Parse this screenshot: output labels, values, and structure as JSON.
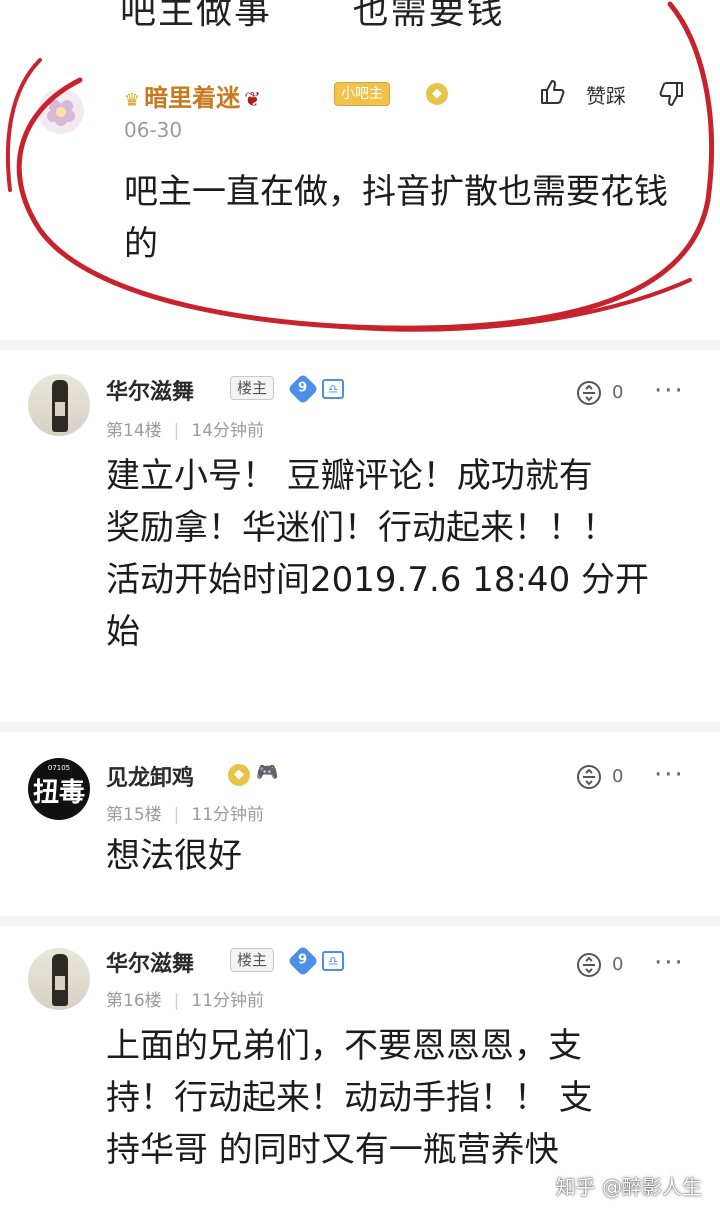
{
  "top_fragment": "吧主做事... 也需要钱",
  "replies": [
    {
      "username": "暗里着迷",
      "badge": "小吧主",
      "date": "06-30",
      "like_label": "赞踩",
      "content": "吧主一直在做，抖音扩散也需要花钱的"
    },
    {
      "username": "华尔滋舞",
      "badge": "楼主",
      "level": "9",
      "floor": "第14楼",
      "time": "14分钟前",
      "reply_count": "0",
      "content_lines": [
        "建立小号！ 豆瓣评论！成功就有",
        "奖励拿！华迷们！行动起来！！！",
        "活动开始时间2019.7.6 18:40 分开",
        "始"
      ]
    },
    {
      "username": "见龙卸鸡",
      "avatar_text": "扭毒",
      "floor": "第15楼",
      "time": "11分钟前",
      "reply_count": "0",
      "content": "想法很好"
    },
    {
      "username": "华尔滋舞",
      "badge": "楼主",
      "level": "9",
      "floor": "第16楼",
      "time": "11分钟前",
      "reply_count": "0",
      "content_lines": [
        "上面的兄弟们，不要恩恩恩，支",
        "持！行动起来！动动手指！！ 支",
        "持华哥 的同时又有一瓶营养快"
      ]
    }
  ],
  "more_label": "···",
  "watermark": "知乎 @醉影人生",
  "colors": {
    "highlight_oval": "#c8232c",
    "username_orange": "#c77a1d",
    "meta_gray": "#9b9b9b"
  }
}
